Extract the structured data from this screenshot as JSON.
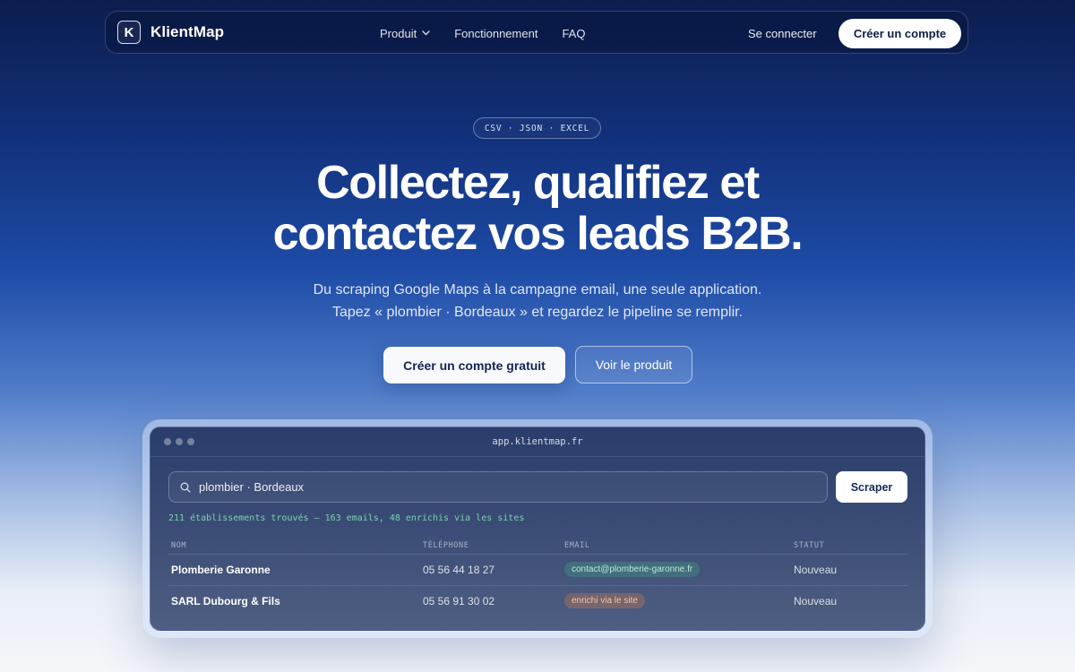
{
  "nav": {
    "logo_letter": "K",
    "brand": "KlientMap",
    "links": [
      "Produit",
      "Fonctionnement",
      "FAQ"
    ],
    "login": "Se connecter",
    "signup": "Créer un compte"
  },
  "hero": {
    "badge": "CSV · JSON · EXCEL",
    "headline_line1": "Collectez, qualifiez et",
    "headline_line2": "contactez vos leads B2B.",
    "sub_line1": "Du scraping Google Maps à la campagne email, une seule application.",
    "sub_line2": "Tapez « plombier · Bordeaux » et regardez le pipeline se remplir.",
    "cta_primary": "Créer un compte gratuit",
    "cta_secondary": "Voir le produit"
  },
  "app": {
    "url": "app.klientmap.fr",
    "search_value": "plombier · Bordeaux",
    "scrape_button": "Scraper",
    "results_summary": "211 établissements trouvés — 163 emails, 48 enrichis via les sites",
    "columns": [
      "NOM",
      "TÉLÉPHONE",
      "EMAIL",
      "STATUT"
    ],
    "rows": [
      {
        "name": "Plomberie Garonne",
        "phone": "05 56 44 18 27",
        "email": "contact@plomberie-garonne.fr",
        "status": "Nouveau"
      },
      {
        "name": "SARL Dubourg & Fils",
        "phone": "05 56 91 30 02",
        "email": "enrichi via le site",
        "status": "Nouveau"
      }
    ]
  },
  "colors": {
    "bg_top": "#0b1d4e",
    "bg_mid": "#1d4ba6",
    "bg_bottom": "#f4f6fa",
    "accent_green": "#7ad1b0",
    "pill_orange": "#f2c7a5"
  },
  "icons": [
    "chevron-down-icon",
    "search-icon"
  ]
}
